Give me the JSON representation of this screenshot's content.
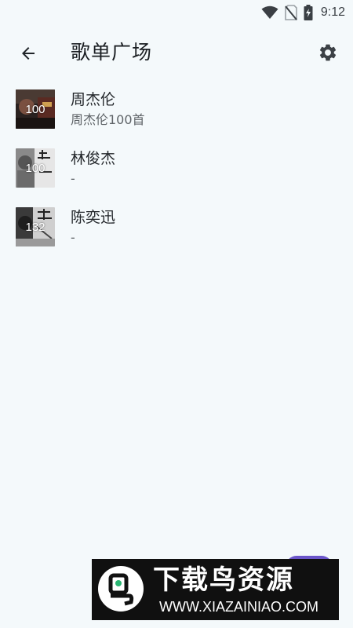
{
  "status_bar": {
    "time": "9:12",
    "icons": [
      "wifi-icon",
      "no-sim-icon",
      "battery-charging-icon"
    ]
  },
  "app_bar": {
    "back_icon": "arrow-left-icon",
    "title": "歌单广场",
    "settings_icon": "gear-icon"
  },
  "playlists": [
    {
      "cover_count": "100",
      "title": "周杰伦",
      "subtitle": "周杰伦100首"
    },
    {
      "cover_count": "100",
      "title": "林俊杰",
      "subtitle": "-"
    },
    {
      "cover_count": "132",
      "title": "陈奕迅",
      "subtitle": "-"
    }
  ],
  "watermark": {
    "title": "下载鸟资源",
    "url": "WWW.XIAZAINIAO.COM"
  },
  "colors": {
    "background": "#f4f9fb",
    "fab": "#6a55c9",
    "watermark_bg": "#101010"
  }
}
